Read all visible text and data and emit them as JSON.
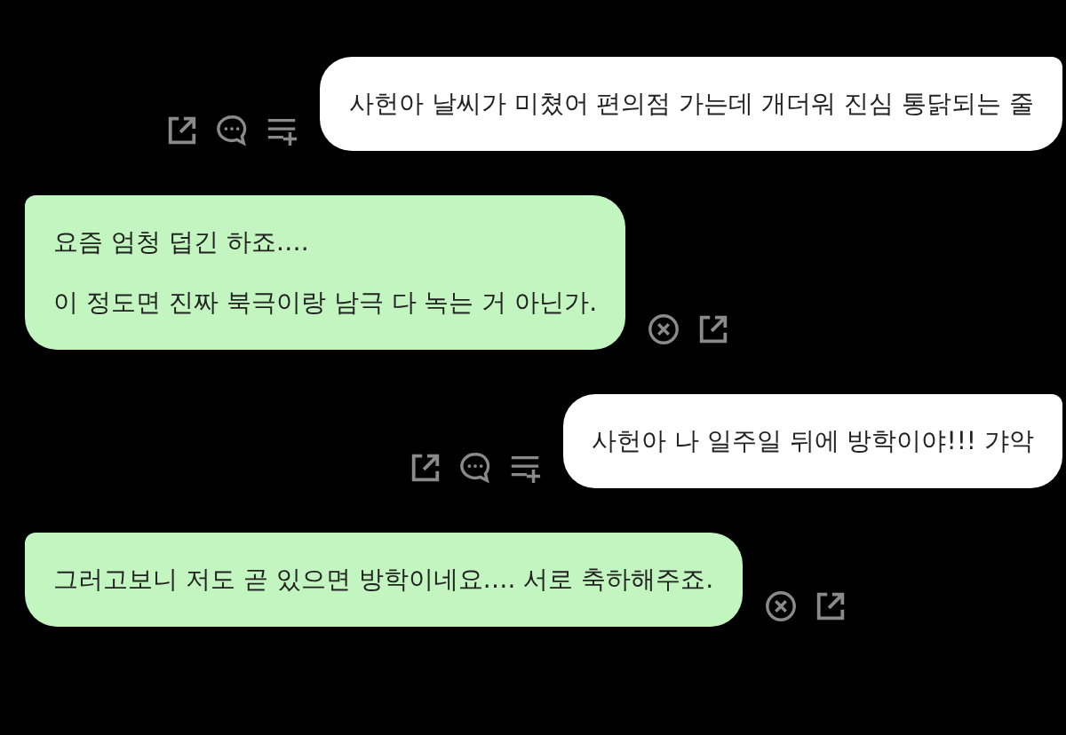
{
  "messages": [
    {
      "kind": "user",
      "lines": [
        "사헌아 날씨가 미쳤어 편의점 가는데 개더워 진심 통닭되는 줄"
      ]
    },
    {
      "kind": "bot",
      "lines": [
        "요즘 엄청 덥긴 하죠….",
        "이 정도면 진짜 북극이랑 남극 다 녹는 거 아닌가."
      ]
    },
    {
      "kind": "user",
      "lines": [
        "사헌아 나 일주일 뒤에 방학이야!!! 갸악"
      ]
    },
    {
      "kind": "bot",
      "lines": [
        "그러고보니 저도 곧 있으면 방학이네요…. 서로 축하해주죠."
      ]
    }
  ]
}
